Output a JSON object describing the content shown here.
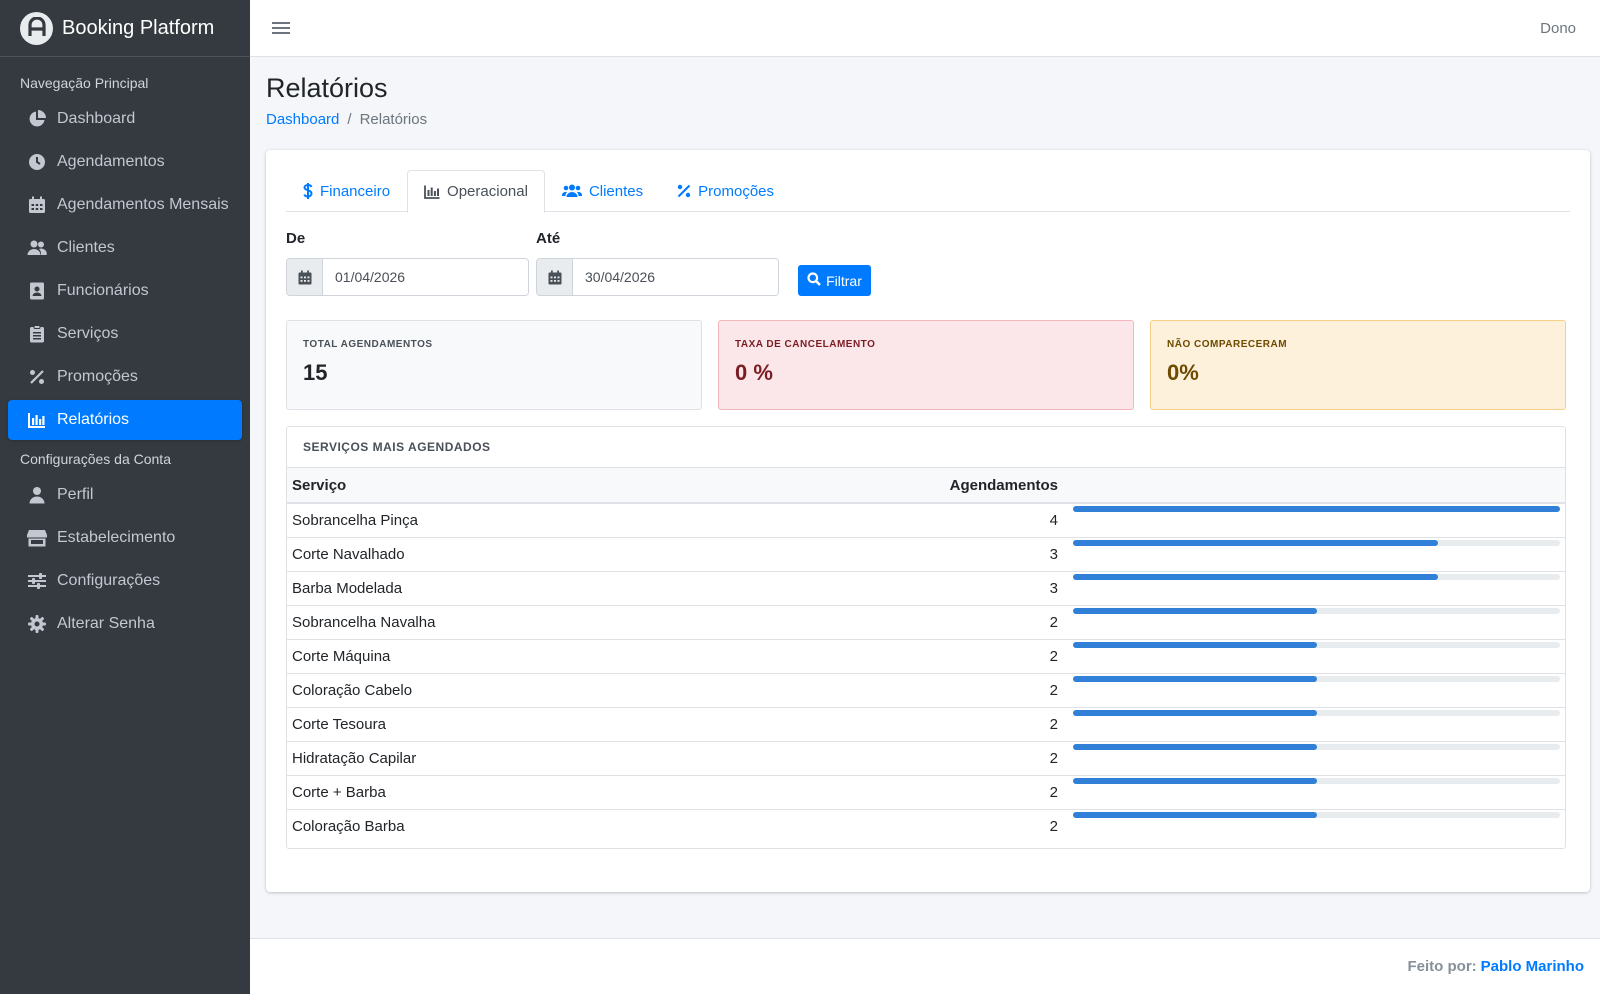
{
  "app": {
    "title": "Booking Platform",
    "logo_icon": "brand-logo-icon"
  },
  "topbar": {
    "user": "Dono",
    "menu_icon": "hamburger-icon"
  },
  "sidebar": {
    "section_main": "Navegação Principal",
    "main_items": [
      {
        "label": "Dashboard",
        "icon": "chart-pie-icon"
      },
      {
        "label": "Agendamentos",
        "icon": "clock-icon"
      },
      {
        "label": "Agendamentos Mensais",
        "icon": "calendar-icon"
      },
      {
        "label": "Clientes",
        "icon": "users-icon"
      },
      {
        "label": "Funcionários",
        "icon": "id-badge-icon"
      },
      {
        "label": "Serviços",
        "icon": "clipboard-icon"
      },
      {
        "label": "Promoções",
        "icon": "percent-icon"
      },
      {
        "label": "Relatórios",
        "icon": "bar-chart-icon",
        "active": true
      }
    ],
    "section_account": "Configurações da Conta",
    "account_items": [
      {
        "label": "Perfil",
        "icon": "user-icon"
      },
      {
        "label": "Estabelecimento",
        "icon": "store-icon"
      },
      {
        "label": "Configurações",
        "icon": "sliders-icon"
      },
      {
        "label": "Alterar Senha",
        "icon": "gear-icon"
      }
    ],
    "active_color": "#007bff"
  },
  "page": {
    "title": "Relatórios",
    "breadcrumb": {
      "home": "Dashboard",
      "separator": "/",
      "current": "Relatórios"
    }
  },
  "tabs": [
    {
      "label": "Financeiro",
      "icon": "dollar-icon"
    },
    {
      "label": "Operacional",
      "icon": "bar-chart-icon",
      "active": true
    },
    {
      "label": "Clientes",
      "icon": "users-icon"
    },
    {
      "label": "Promoções",
      "icon": "percent-icon"
    }
  ],
  "filter": {
    "from_label": "De",
    "from_value": "01/04/2026",
    "to_label": "Até",
    "to_value": "30/04/2026",
    "button": "Filtrar"
  },
  "stats": {
    "total": {
      "label": "TOTAL AGENDAMENTOS",
      "value": "15"
    },
    "cancel": {
      "label": "TAXA DE CANCELAMENTO",
      "value": "0 %"
    },
    "noshow": {
      "label": "NÃO COMPARECERAM",
      "value": "0%"
    }
  },
  "services": {
    "title": "SERVIÇOS MAIS AGENDADOS",
    "columns": {
      "service": "Serviço",
      "count": "Agendamentos"
    },
    "max": 4,
    "bar_color": "#2f80d6",
    "rows": [
      {
        "name": "Sobrancelha Pinça",
        "count": 4
      },
      {
        "name": "Corte Navalhado",
        "count": 3
      },
      {
        "name": "Barba Modelada",
        "count": 3
      },
      {
        "name": "Sobrancelha Navalha",
        "count": 2
      },
      {
        "name": "Corte Máquina",
        "count": 2
      },
      {
        "name": "Coloração Cabelo",
        "count": 2
      },
      {
        "name": "Corte Tesoura",
        "count": 2
      },
      {
        "name": "Hidratação Capilar",
        "count": 2
      },
      {
        "name": "Corte + Barba",
        "count": 2
      },
      {
        "name": "Coloração Barba",
        "count": 2
      }
    ]
  },
  "footer": {
    "prefix": "Feito por:",
    "author": "Pablo Marinho"
  }
}
